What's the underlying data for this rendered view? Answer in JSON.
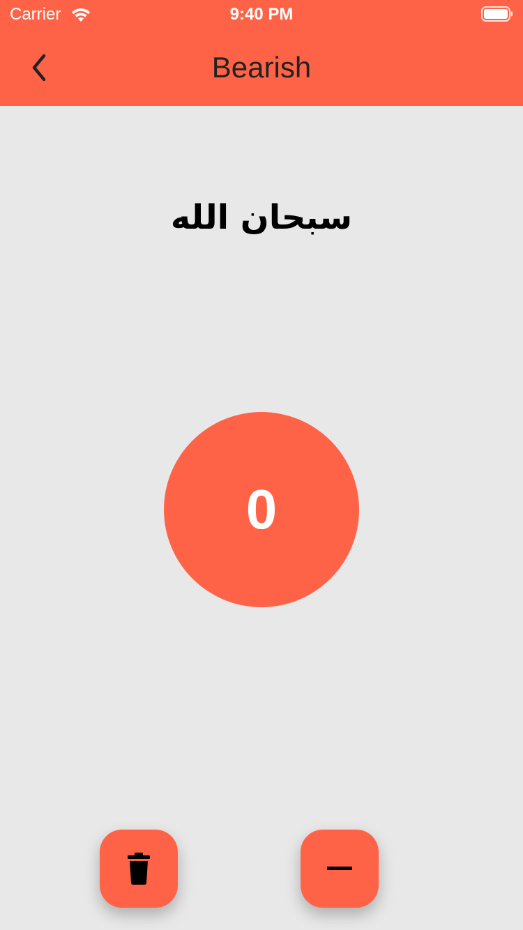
{
  "status_bar": {
    "carrier": "Carrier",
    "time": "9:40 PM"
  },
  "nav": {
    "title": "Bearish",
    "back_icon": "chevron-left-icon"
  },
  "dhikr": {
    "text": "سبحان الله"
  },
  "counter": {
    "value": "0"
  },
  "actions": {
    "reset_icon": "trash-icon",
    "decrement_icon": "minus-icon"
  },
  "colors": {
    "accent": "#ff6347",
    "background": "#e8e8e8"
  }
}
